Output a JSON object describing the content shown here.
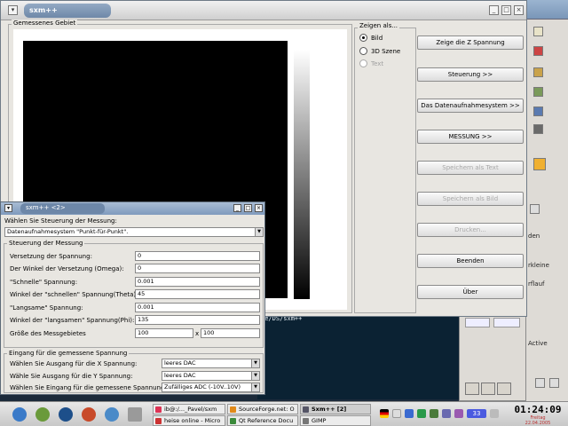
{
  "main_window": {
    "title": "sxm++",
    "frame_label": "Gemessenes Gebiet",
    "view_group_label": "Zeigen als...",
    "view_options": [
      {
        "label": "Bild",
        "selected": true,
        "enabled": true
      },
      {
        "label": "3D Szene",
        "selected": false,
        "enabled": true
      },
      {
        "label": "Text",
        "selected": false,
        "enabled": false
      }
    ],
    "buttons": [
      {
        "label": "Zeige die Z Spannung",
        "enabled": true
      },
      {
        "label": "Steuerung >>",
        "enabled": true
      },
      {
        "label": "Das Datenaufnahmesystem >>",
        "enabled": true
      },
      {
        "label": "MESSUNG >>",
        "enabled": true
      },
      {
        "label": "Speichern als Text",
        "enabled": false
      },
      {
        "label": "Speichern als Bild",
        "enabled": false
      },
      {
        "label": "Drucken...",
        "enabled": false
      },
      {
        "label": "Beenden",
        "enabled": true
      },
      {
        "label": "Über",
        "enabled": true
      }
    ]
  },
  "dialog": {
    "title": "sxm++ <2>",
    "control_prompt": "Wählen Sie Steuerung der Messung:",
    "control_value": "Datenaufnahmesystem \"Punkt-für-Punkt\".",
    "control_group_label": "Steuerung der Messung",
    "fields": [
      {
        "label": "Versetzung der Spannung:",
        "value": "0"
      },
      {
        "label": "Der Winkel der Versetzung (Omega):",
        "value": "0"
      },
      {
        "label": "\"Schnelle\" Spannung:",
        "value": "0.001"
      },
      {
        "label": "Winkel der \"schnellen\" Spannung(Theta):",
        "value": "45"
      },
      {
        "label": "\"Langsame\" Spannung:",
        "value": "0.001"
      },
      {
        "label": "Winkel der \"langsamen\" Spannung(Phi):",
        "value": "135"
      }
    ],
    "size_label": "Größe des Messgebietes",
    "size_x": "100",
    "size_sep": "x",
    "size_y": "100",
    "input_group_label": "Eingang für die gemessene Spannung",
    "selects": [
      {
        "label": "Wählen Sie Ausgang für die X Spannung:",
        "value": "leeres DAC"
      },
      {
        "label": "Wähle Sie Ausgang für die Y Spannung:",
        "value": "leeres DAC"
      },
      {
        "label": "Wählen Sie Eingang für die gemessene Spannung:",
        "value": "Zufälliges ADC (-10V..10V)"
      }
    ]
  },
  "terminal": {
    "line": "xe/DS/sxm++"
  },
  "right_app": {
    "labels": [
      "den",
      "rkleine",
      "rflauf",
      "Active"
    ]
  },
  "taskbar": {
    "tasks": [
      {
        "label": "ib@:/..._Pavel/sxm",
        "active": false
      },
      {
        "label": "SourceForge.net: O",
        "active": false
      },
      {
        "label": "Sxm++ [2]",
        "active": true
      },
      {
        "label": "heise online - Micro",
        "active": false
      },
      {
        "label": "Qt Reference Docu",
        "active": false
      },
      {
        "label": "GIMP",
        "active": false
      }
    ],
    "tray_number": "33",
    "clock_time": "01:24:09",
    "clock_day": "Freitag",
    "clock_date": "22.04.2005"
  }
}
